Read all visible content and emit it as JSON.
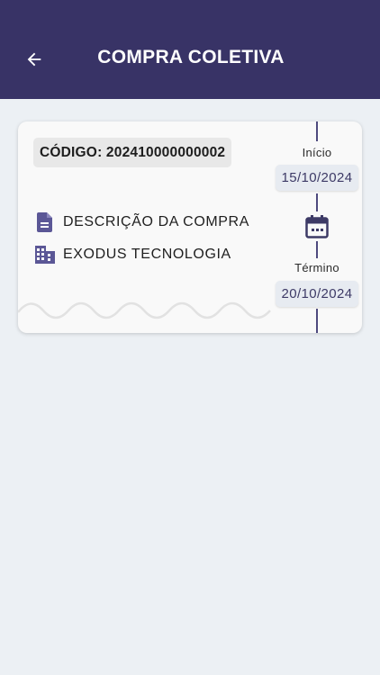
{
  "header": {
    "title": "COMPRA COLETIVA",
    "back_icon": "arrow-left-icon"
  },
  "card": {
    "code_label": "CÓDIGO: 202410000000002",
    "description": "DESCRIÇÃO DA COMPRA",
    "description_icon": "document-icon",
    "company": "EXODUS TECNOLOGIA",
    "company_icon": "building-icon",
    "timeline": {
      "start_label": "Início",
      "start_date": "15/10/2024",
      "calendar_icon": "calendar-icon",
      "end_label": "Término",
      "end_date": "20/10/2024"
    }
  },
  "colors": {
    "header_bg": "#383366",
    "accent": "#5b5796",
    "page_bg": "#ecf0f4",
    "card_bg": "#f9f9f9"
  }
}
